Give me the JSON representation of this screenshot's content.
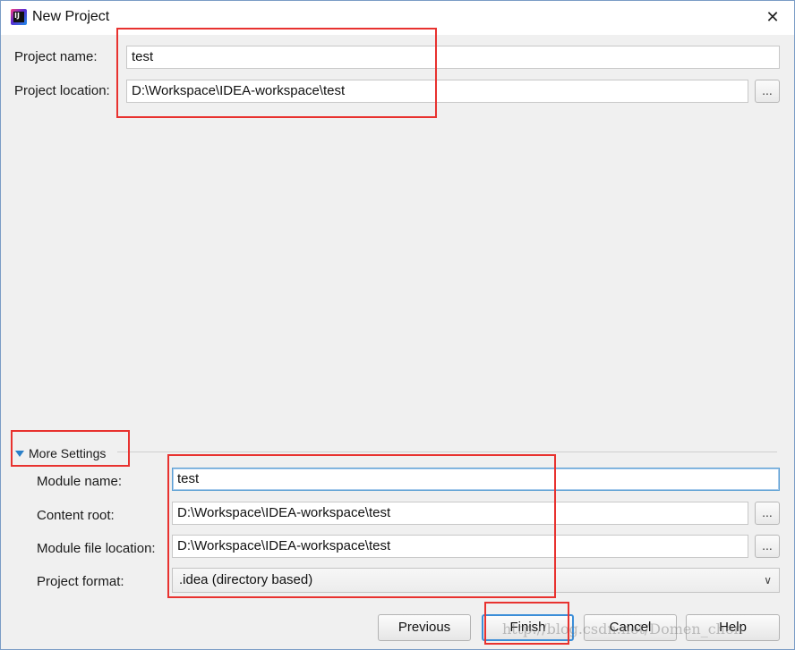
{
  "window": {
    "title": "New Project",
    "close_label": "✕"
  },
  "project": {
    "name_label": "Project name:",
    "name_value": "test",
    "location_label": "Project location:",
    "location_value": "D:\\Workspace\\IDEA-workspace\\test",
    "browse_label": "..."
  },
  "more_settings": {
    "label": "More Settings",
    "module_name_label": "Module name:",
    "module_name_value": "test",
    "content_root_label": "Content root:",
    "content_root_value": "D:\\Workspace\\IDEA-workspace\\test",
    "module_file_label": "Module file location:",
    "module_file_value": "D:\\Workspace\\IDEA-workspace\\test",
    "project_format_label": "Project format:",
    "project_format_value": ".idea (directory based)",
    "browse_label": "..."
  },
  "buttons": {
    "previous": "Previous",
    "finish": "Finish",
    "cancel": "Cancel",
    "help": "Help"
  },
  "watermark": "http://blog.csdn.net/Domen_chen",
  "colors": {
    "highlight": "#e8322f",
    "accent": "#3b8ed8"
  }
}
